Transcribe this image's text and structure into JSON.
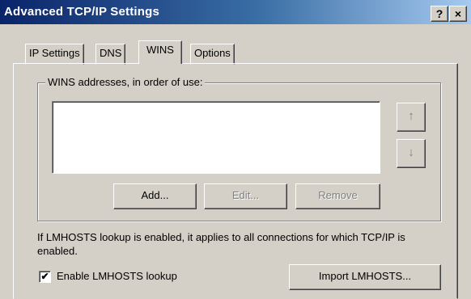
{
  "window": {
    "title": "Advanced TCP/IP Settings",
    "help_label": "?",
    "close_label": "×"
  },
  "tabs": [
    {
      "label": "IP Settings"
    },
    {
      "label": "DNS"
    },
    {
      "label": "WINS",
      "active": true
    },
    {
      "label": "Options"
    }
  ],
  "wins": {
    "group_label": "WINS addresses, in order of use:",
    "addresses": [],
    "up_arrow": "↑",
    "down_arrow": "↓",
    "add_label": "Add...",
    "edit_label": "Edit...",
    "remove_label": "Remove"
  },
  "lmhosts": {
    "info_text": "If LMHOSTS lookup is enabled, it applies to all connections for which TCP/IP is enabled.",
    "enable_label": "Enable LMHOSTS lookup",
    "enable_checked": true,
    "check_mark": "✔",
    "import_label": "Import LMHOSTS..."
  },
  "colors": {
    "title_start": "#0a246a",
    "title_end": "#a6caf0",
    "face": "#d4d0c8"
  }
}
